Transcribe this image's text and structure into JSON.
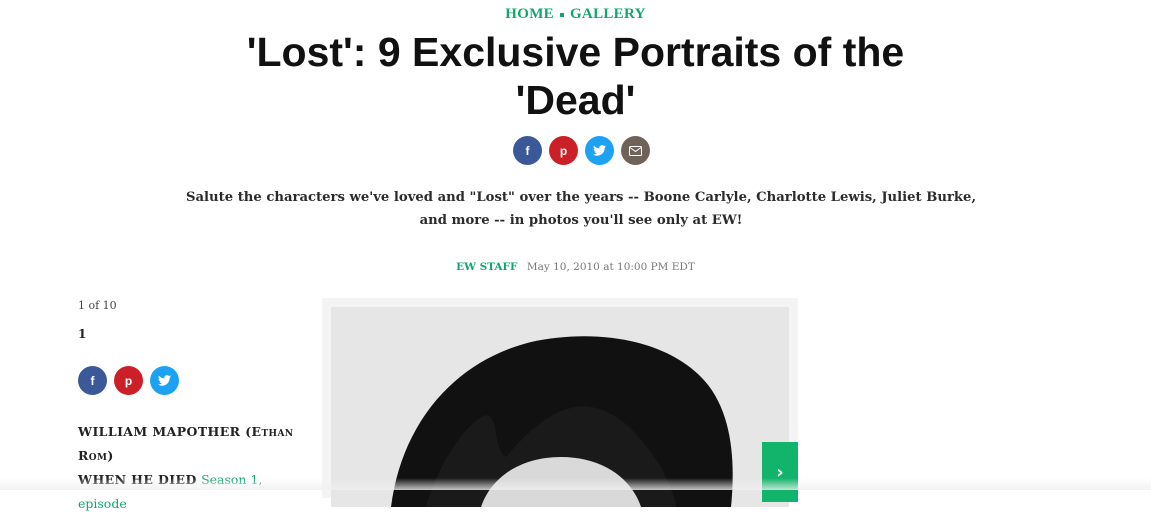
{
  "breadcrumb": {
    "home": "HOME",
    "gallery": "GALLERY"
  },
  "title": "'Lost': 9 Exclusive Portraits of the 'Dead'",
  "share_top": [
    {
      "name": "facebook-icon",
      "glyph": "f"
    },
    {
      "name": "pinterest-icon",
      "glyph": "p"
    },
    {
      "name": "twitter-icon",
      "glyph": "t"
    },
    {
      "name": "email-icon",
      "glyph": "✉"
    }
  ],
  "description": "Salute the characters we've loved and \"Lost\" over the years -- Boone Carlyle, Charlotte Lewis, Juliet Burke, and more -- in photos you'll see only at EW!",
  "byline": {
    "author": "EW STAFF",
    "date": "May 10, 2010 at 10:00 PM EDT"
  },
  "slide": {
    "counter": "1 of 10",
    "number": "1",
    "caption_name": "WILLIAM MAPOTHER (Ethan Rom)",
    "when_label": "WHEN HE DIED",
    "when_value": "Season 1, episode"
  },
  "colors": {
    "accent": "#12a66e",
    "facebook": "#3b5998",
    "pinterest": "#cb2027",
    "twitter": "#1da1f2",
    "email": "#6f6258",
    "next": "#12b36a"
  }
}
